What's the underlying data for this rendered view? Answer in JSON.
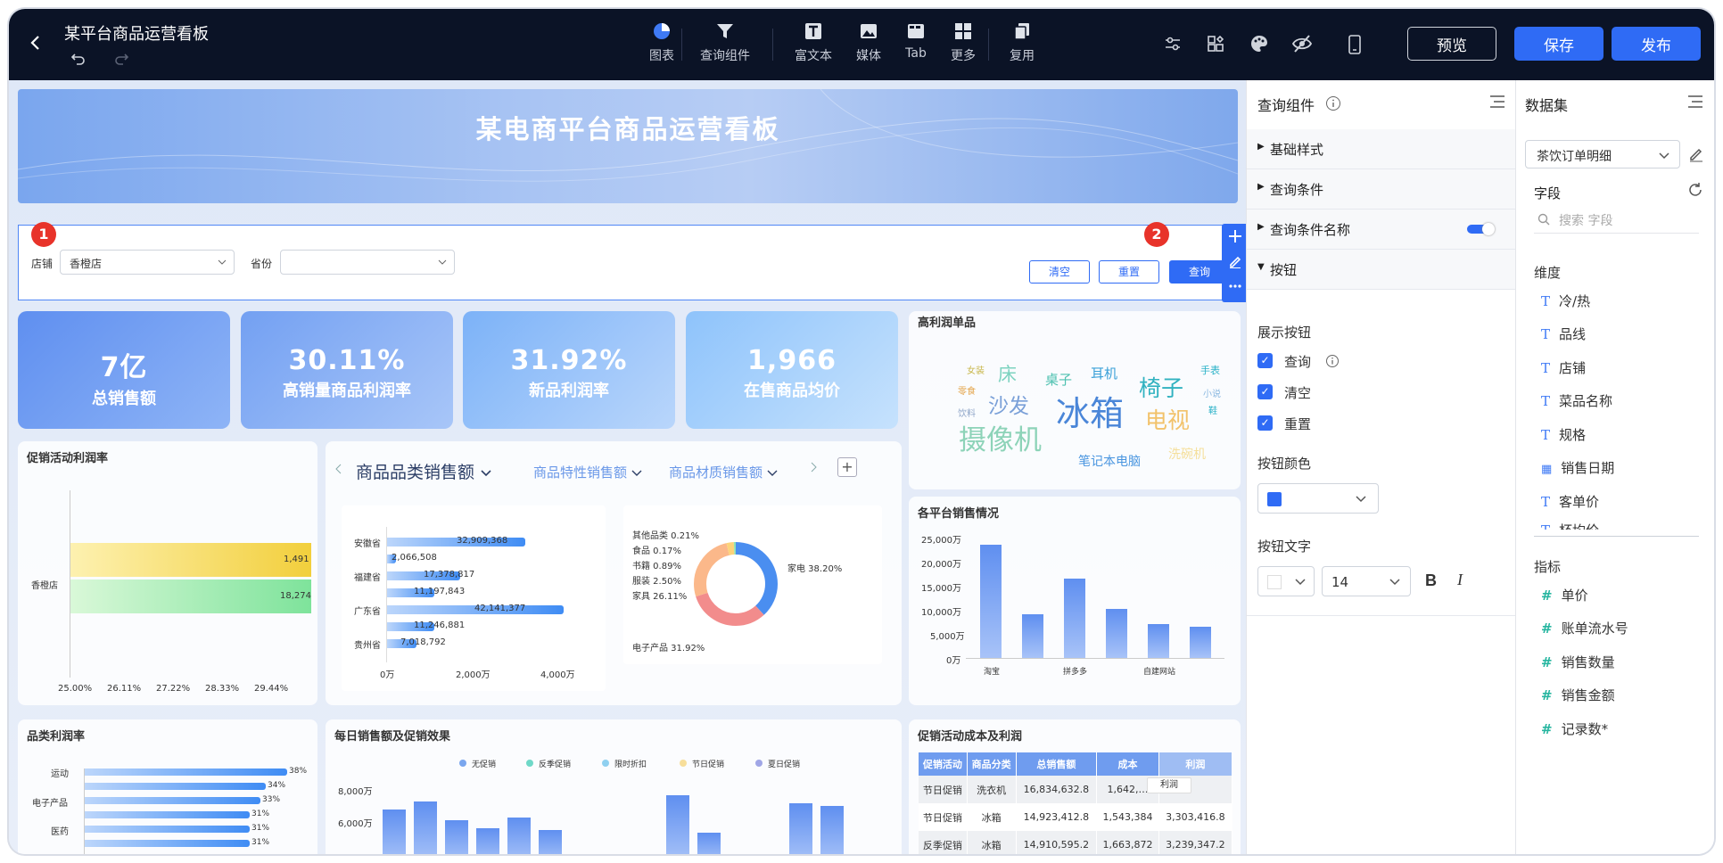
{
  "topbar": {
    "title": "某平台商品运营看板",
    "tools": [
      {
        "label": "图表",
        "icon": "pie-chart-icon"
      },
      {
        "label": "查询组件",
        "icon": "filter-icon"
      },
      {
        "label": "富文本",
        "icon": "text-icon"
      },
      {
        "label": "媒体",
        "icon": "image-icon"
      },
      {
        "label": "Tab",
        "icon": "tab-icon"
      },
      {
        "label": "更多",
        "icon": "grid-icon"
      },
      {
        "label": "复用",
        "icon": "copy-icon"
      }
    ],
    "preview": "预览",
    "save": "保存",
    "publish": "发布"
  },
  "dashboard": {
    "banner_title": "某电商平台商品运营看板",
    "query": {
      "store_label": "店铺",
      "store_value": "香橙店",
      "province_label": "省份",
      "province_value": "",
      "clear": "清空",
      "reset": "重置",
      "search": "查询",
      "marker1": "1",
      "marker2": "2"
    },
    "kpis": [
      {
        "value": "7亿",
        "label": "总销售额"
      },
      {
        "value": "30.11%",
        "label": "高销量商品利润率"
      },
      {
        "value": "31.92%",
        "label": "新品利润率"
      },
      {
        "value": "1,966",
        "label": "在售商品均价"
      }
    ],
    "wordcloud": {
      "title": "高利润单品",
      "words": [
        "床",
        "桌子",
        "耳机",
        "椅子",
        "手表",
        "女装",
        "零食",
        "沙发",
        "冰箱",
        "电视",
        "小说",
        "饮料",
        "摄像机",
        "笔记本电脑",
        "洗碗机",
        "鞋"
      ]
    },
    "promo_profit": {
      "title": "促销活动利润率",
      "category": "香橙店",
      "bars": [
        "1,491",
        "18,274"
      ],
      "ticks": [
        "25.00%",
        "26.11%",
        "27.22%",
        "28.33%",
        "29.44%"
      ]
    },
    "category_sales": {
      "tabs": [
        "商品品类销售额",
        "商品特性销售额",
        "商品材质销售额"
      ],
      "bar_rows": [
        {
          "label": "安徽省",
          "value": "32,909,368"
        },
        {
          "label": "",
          "value": "2,066,508"
        },
        {
          "label": "福建省",
          "value": "17,378,817"
        },
        {
          "label": "",
          "value": "11,197,843"
        },
        {
          "label": "广东省",
          "value": "42,141,377"
        },
        {
          "label": "",
          "value": "11,246,881"
        },
        {
          "label": "贵州省",
          "value": "7,018,792"
        }
      ],
      "bar_ticks": [
        "0万",
        "2,000万",
        "4,000万"
      ],
      "donut_labels": [
        "其他品类 0.21%",
        "食品 0.17%",
        "书籍 0.89%",
        "服装 2.50%",
        "家具 26.11%",
        "电子产品 31.92%",
        "家电 38.20%"
      ]
    },
    "platform_sales": {
      "title": "各平台销售情况",
      "yticks": [
        "25,000万",
        "20,000万",
        "15,000万",
        "10,000万",
        "5,000万",
        "0万"
      ],
      "xlabels": [
        "淘宝",
        "拼多多",
        "自建网站"
      ]
    },
    "category_profit": {
      "title": "品类利润率",
      "rows": [
        {
          "label": "运动",
          "value": "38%"
        },
        {
          "label": "",
          "value": "34%"
        },
        {
          "label": "电子产品",
          "value": "33%"
        },
        {
          "label": "",
          "value": "31%"
        },
        {
          "label": "医药",
          "value": "31%"
        },
        {
          "label": "",
          "value": "31%"
        }
      ]
    },
    "daily_sales": {
      "title": "每日销售额及促销效果",
      "legend": [
        "无促销",
        "反季促销",
        "限时折扣",
        "节日促销",
        "夏日促销"
      ],
      "yticks": [
        "8,000万",
        "6,000万"
      ]
    },
    "promo_cost": {
      "title": "促销活动成本及利润",
      "headers": [
        "促销活动",
        "商品分类",
        "总销售额",
        "成本",
        "利润"
      ],
      "rows": [
        [
          "节日促销",
          "洗衣机",
          "16,834,632.8",
          "1,642,…",
          ""
        ],
        [
          "节日促销",
          "冰箱",
          "14,923,412.8",
          "1,543,384",
          "3,303,416.8"
        ],
        [
          "反季促销",
          "冰箱",
          "14,910,595.2",
          "1,663,872",
          "3,239,347.2"
        ]
      ],
      "tooltip": "利润"
    }
  },
  "query_panel": {
    "title": "查询组件",
    "sections": [
      "基础样式",
      "查询条件",
      "查询条件名称",
      "按钮"
    ],
    "show_buttons_label": "展示按钮",
    "buttons": [
      "查询",
      "清空",
      "重置"
    ],
    "button_color_label": "按钮颜色",
    "button_text_label": "按钮文字",
    "font_size": "14",
    "accent": "#2f6bf5"
  },
  "dataset_panel": {
    "title": "数据集",
    "dataset": "茶饮订单明细",
    "fields_label": "字段",
    "search_placeholder": "搜索 字段",
    "dimensions_label": "维度",
    "dimensions": [
      "冷/热",
      "品线",
      "店铺",
      "菜品名称",
      "规格",
      "销售日期",
      "客单价",
      "杯均价"
    ],
    "measures_label": "指标",
    "measures": [
      "单价",
      "账单流水号",
      "销售数量",
      "销售金额",
      "记录数*"
    ]
  }
}
